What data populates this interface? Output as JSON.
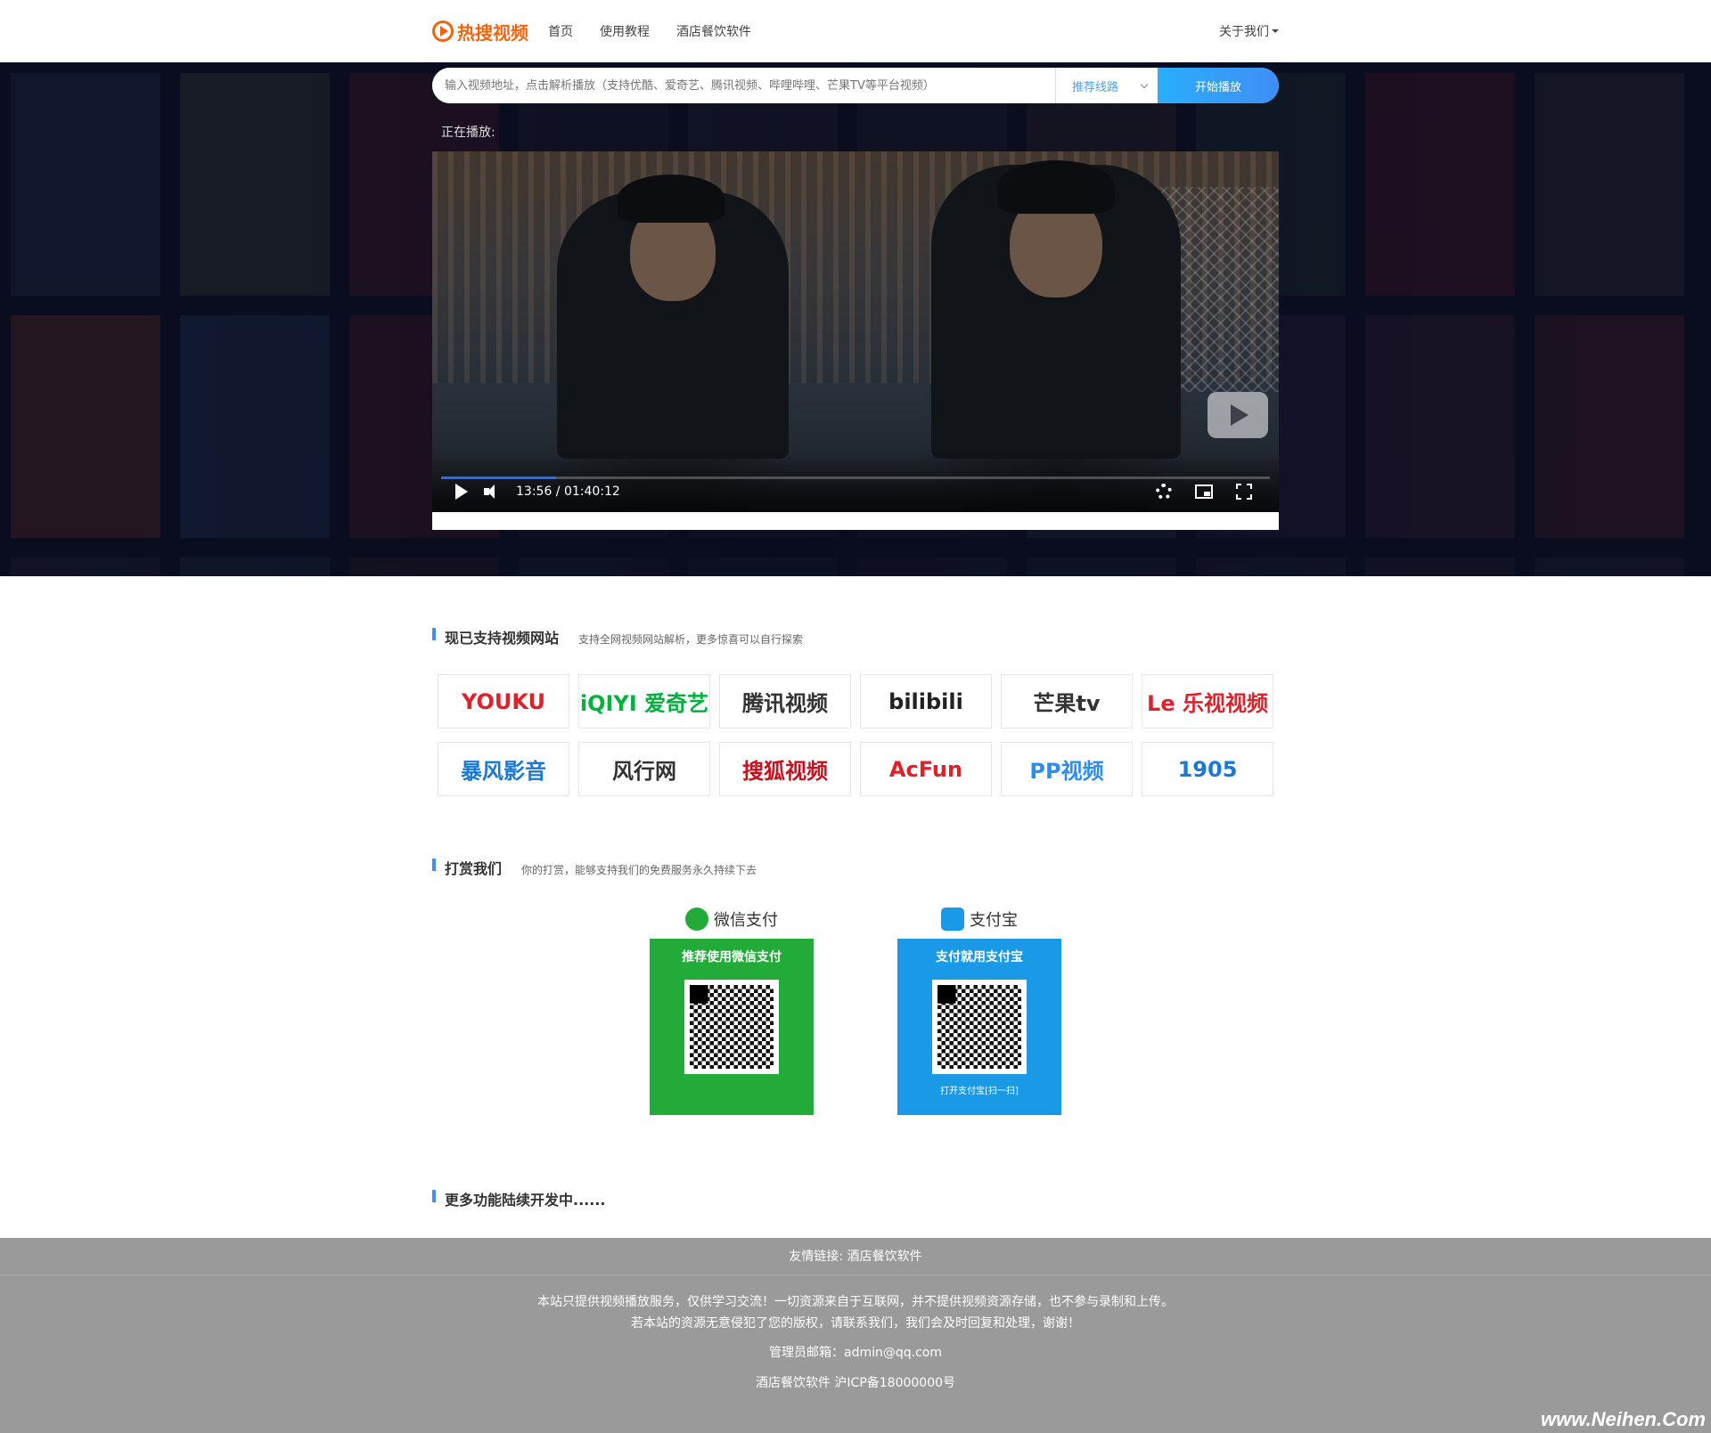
{
  "header": {
    "logo_text": "热搜视频",
    "nav": [
      {
        "label": "首页"
      },
      {
        "label": "使用教程"
      },
      {
        "label": "酒店餐饮软件"
      }
    ],
    "about": "关于我们"
  },
  "search": {
    "placeholder": "输入视频地址，点击解析播放（支持优酷、爱奇艺、腾讯视频、哔哩哔哩、芒果TV等平台视频）",
    "route": "推荐线路",
    "button": "开始播放"
  },
  "player": {
    "now_playing_label": "正在播放:",
    "time": "13:56 / 01:40:12",
    "progress_fraction": 0.139
  },
  "supported": {
    "title": "现已支持视频网站",
    "subtitle": "支持全网视频网站解析，更多惊喜可以自行探索",
    "sites": [
      {
        "name": "YOUKU",
        "color": "#e0212a"
      },
      {
        "name": "iQIYI 爱奇艺",
        "color": "#00b33c"
      },
      {
        "name": "腾讯视频",
        "color": "#333333"
      },
      {
        "name": "bilibili",
        "color": "#222222"
      },
      {
        "name": "芒果tv",
        "color": "#333333"
      },
      {
        "name": "Le 乐视视频",
        "color": "#e0212a"
      },
      {
        "name": "暴风影音",
        "color": "#1a78d6"
      },
      {
        "name": "风行网",
        "color": "#333333"
      },
      {
        "name": "搜狐视频",
        "color": "#c8101e"
      },
      {
        "name": "AcFun",
        "color": "#e0212a"
      },
      {
        "name": "PP视频",
        "color": "#2a8ef0"
      },
      {
        "name": "1905",
        "color": "#1a78d6"
      }
    ]
  },
  "donate": {
    "title": "打赏我们",
    "subtitle": "你的打赏，能够支持我们的免费服务永久持续下去",
    "wechat": {
      "head": "微信支付",
      "body": "推荐使用微信支付",
      "color": "#22ab38"
    },
    "alipay": {
      "head": "支付宝",
      "body": "支付就用支付宝",
      "foot": "打开支付宝[扫一扫]",
      "color": "#1a9ae6"
    }
  },
  "more": {
    "title": "更多功能陆续开发中......"
  },
  "footer": {
    "links_label": "友情链接:",
    "link": "酒店餐饮软件",
    "disclaimer1": "本站只提供视频播放服务，仅供学习交流！一切资源来自于互联网，并不提供视频资源存储，也不参与录制和上传。",
    "disclaimer2": "若本站的资源无意侵犯了您的版权，请联系我们，我们会及时回复和处理，谢谢！",
    "email": "管理员邮箱：admin@qq.com",
    "icp": "酒店餐饮软件  沪ICP备18000000号"
  },
  "watermark": "www.Neihen.Com"
}
